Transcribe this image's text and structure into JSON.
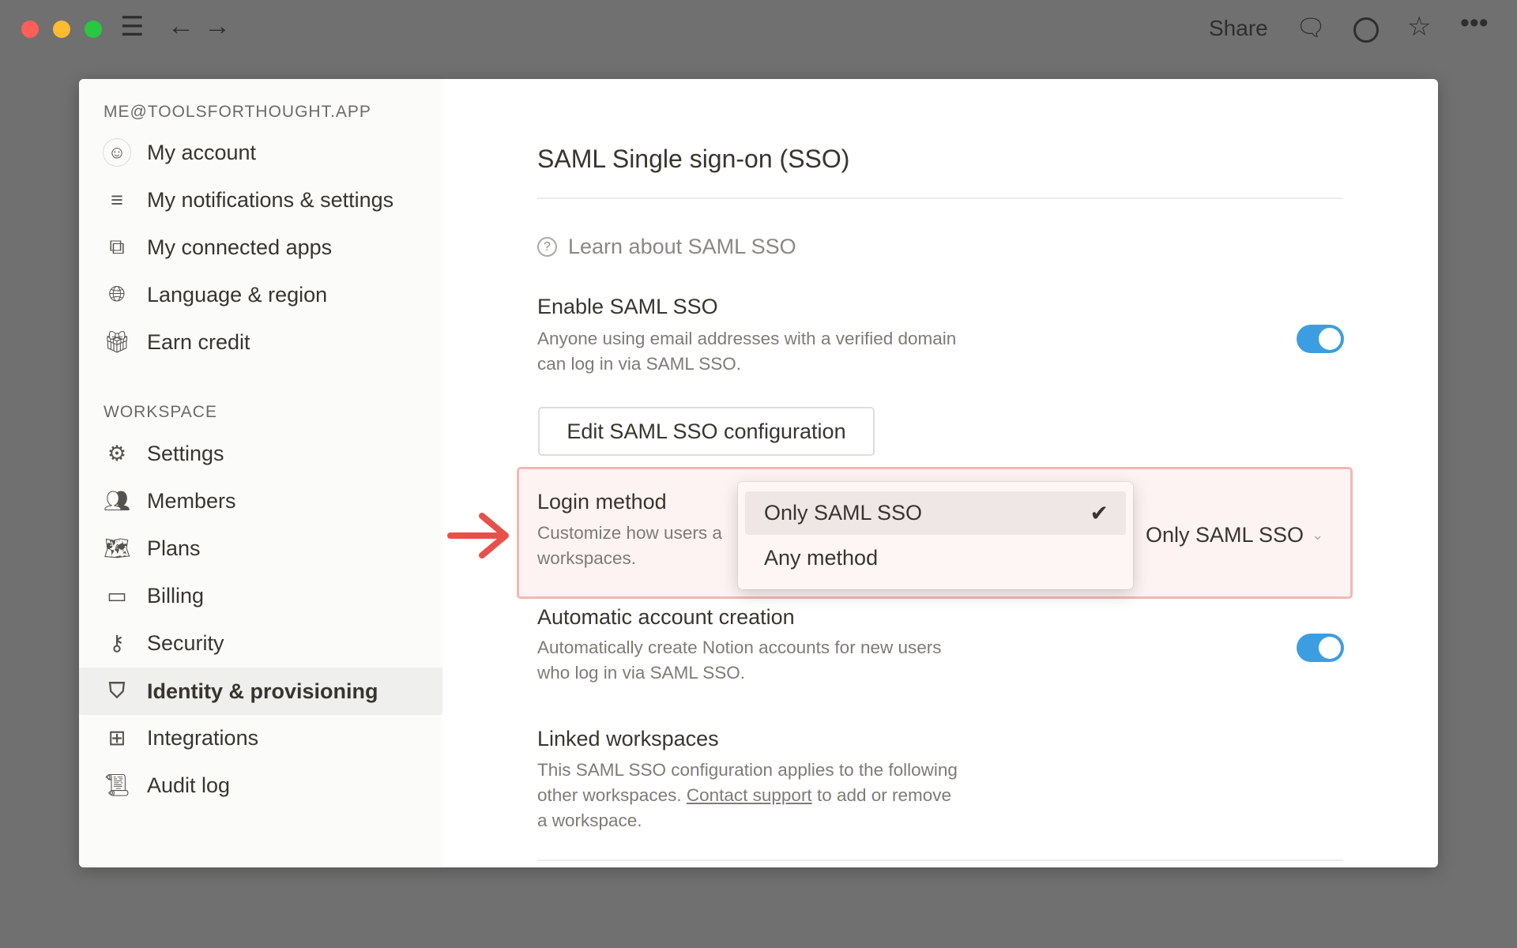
{
  "titlebar": {
    "share": "Share",
    "icons": [
      "menu-icon",
      "back-arrow-icon",
      "forward-arrow-icon",
      "comment-icon",
      "history-icon",
      "star-icon",
      "more-icon"
    ]
  },
  "sidebar": {
    "account_label": "ME@TOOLSFORTHOUGHT.APP",
    "account_items": [
      {
        "label": "My account",
        "icon": "avatar"
      },
      {
        "label": "My notifications & settings",
        "icon": "sliders-icon"
      },
      {
        "label": "My connected apps",
        "icon": "external-link-icon"
      },
      {
        "label": "Language & region",
        "icon": "globe-icon"
      },
      {
        "label": "Earn credit",
        "icon": "gift-icon"
      }
    ],
    "workspace_label": "WORKSPACE",
    "workspace_items": [
      {
        "label": "Settings",
        "icon": "gear-icon"
      },
      {
        "label": "Members",
        "icon": "people-icon"
      },
      {
        "label": "Plans",
        "icon": "map-icon"
      },
      {
        "label": "Billing",
        "icon": "credit-card-icon"
      },
      {
        "label": "Security",
        "icon": "key-icon"
      },
      {
        "label": "Identity & provisioning",
        "icon": "shield-icon",
        "selected": true
      },
      {
        "label": "Integrations",
        "icon": "grid-icon"
      },
      {
        "label": "Audit log",
        "icon": "scroll-icon"
      }
    ]
  },
  "main": {
    "title": "SAML Single sign-on (SSO)",
    "learn": "Learn about SAML SSO",
    "enable": {
      "title": "Enable SAML SSO",
      "desc1": "Anyone using email addresses with a verified domain",
      "desc2": "can log in via SAML SSO.",
      "on": true
    },
    "edit_button": "Edit SAML SSO configuration",
    "login": {
      "title": "Login method",
      "desc1": "Customize how users a",
      "desc2": "workspaces.",
      "value": "Only SAML SSO",
      "options": [
        "Only SAML SSO",
        "Any method"
      ],
      "selected": "Only SAML SSO"
    },
    "auto": {
      "title": "Automatic account creation",
      "desc1": "Automatically create Notion accounts for new users",
      "desc2": "who log in via SAML SSO.",
      "on": true
    },
    "linked": {
      "title": "Linked workspaces",
      "desc1": "This SAML SSO configuration applies to the following",
      "desc2a": "other workspaces. ",
      "link": "Contact support",
      "desc2b": " to add or remove",
      "desc3": "a workspace."
    }
  },
  "colors": {
    "accent": "#3c9ee0",
    "highlight_border": "#f1b8b6",
    "highlight_bg": "#fdf3f2",
    "arrow": "#e8504a"
  }
}
